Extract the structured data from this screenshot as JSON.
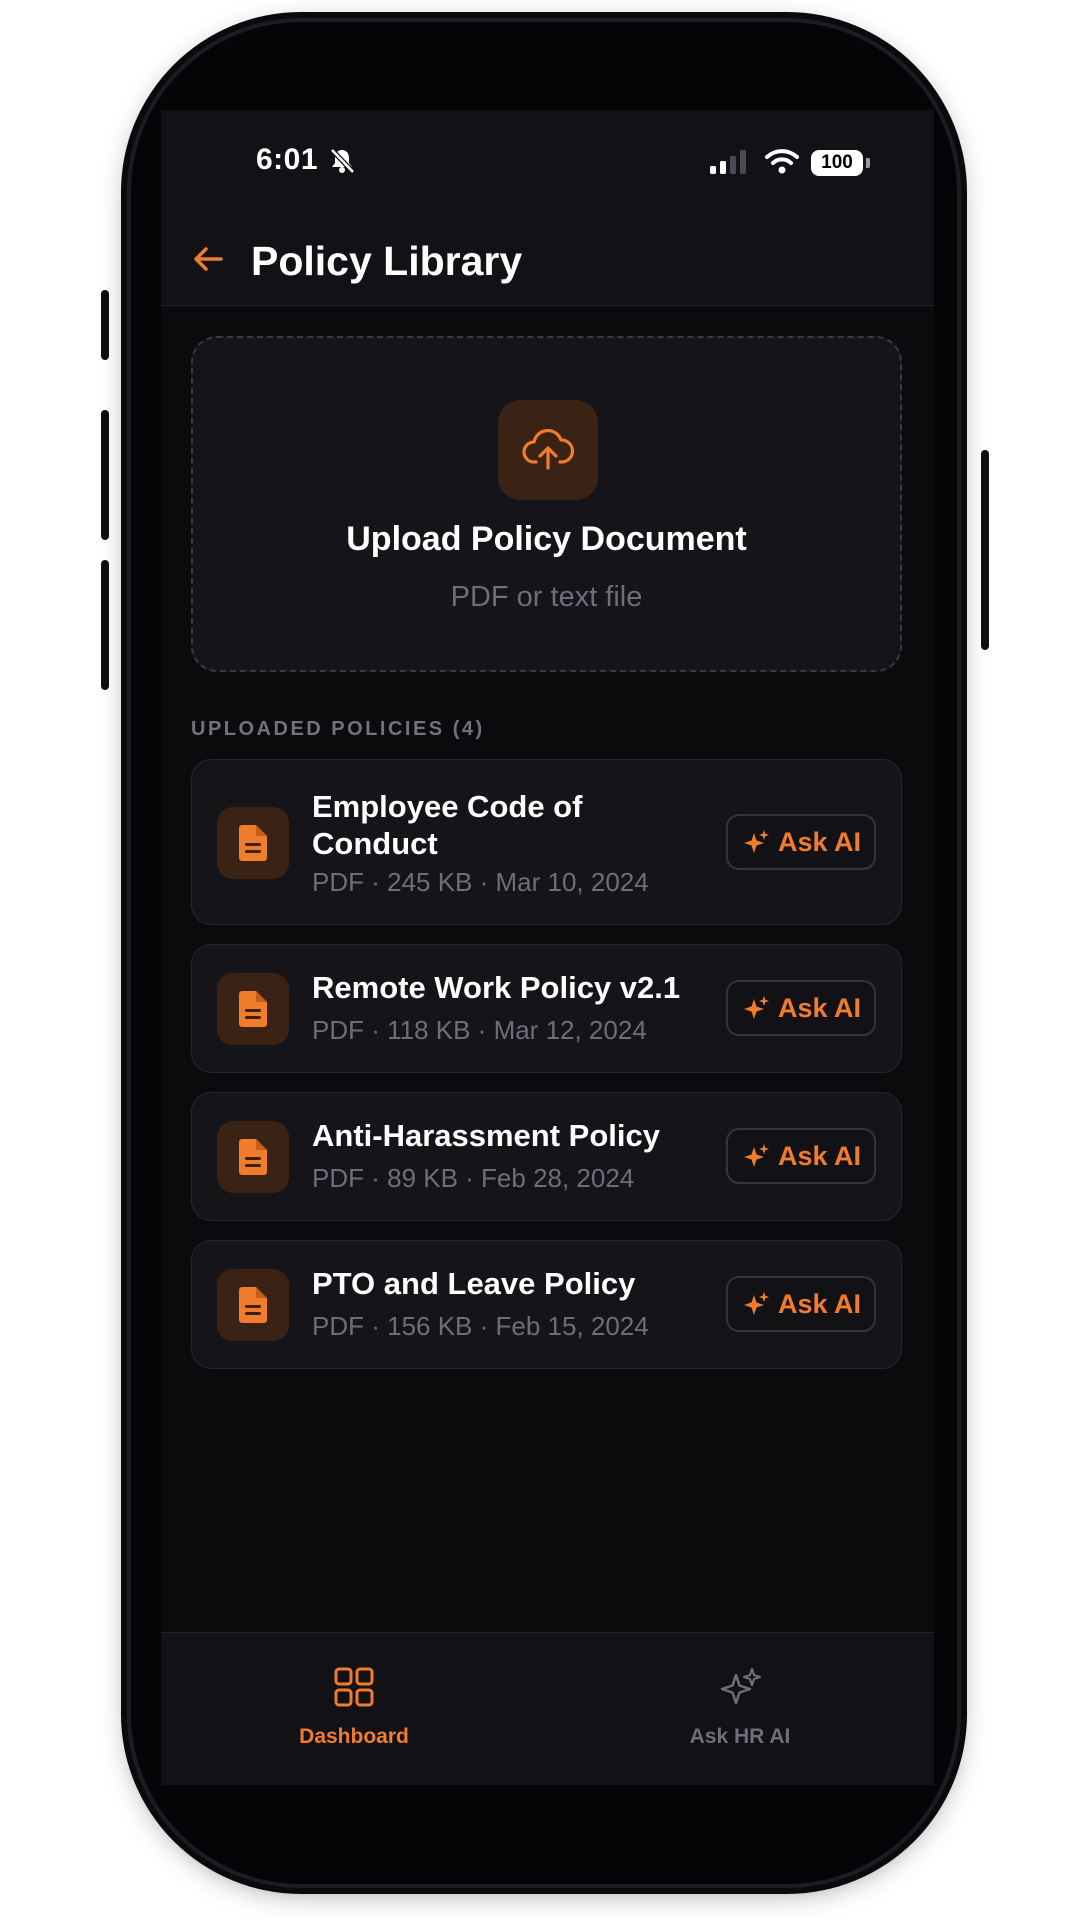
{
  "status_bar": {
    "time": "6:01",
    "battery": "100"
  },
  "header": {
    "title": "Policy Library"
  },
  "upload": {
    "title": "Upload Policy Document",
    "subtitle": "PDF or text file"
  },
  "section": {
    "label": "UPLOADED POLICIES (4)"
  },
  "policies": [
    {
      "title": "Employee Code of Conduct",
      "meta": "PDF · 245 KB · Mar 10, 2024",
      "action": "Ask AI"
    },
    {
      "title": "Remote Work Policy v2.1",
      "meta": "PDF · 118 KB · Mar 12, 2024",
      "action": "Ask AI"
    },
    {
      "title": "Anti-Harassment Policy",
      "meta": "PDF · 89 KB · Feb 28, 2024",
      "action": "Ask AI"
    },
    {
      "title": "PTO and Leave Policy",
      "meta": "PDF · 156 KB · Feb 15, 2024",
      "action": "Ask AI"
    }
  ],
  "bottom_nav": {
    "items": [
      {
        "label": "Dashboard",
        "icon": "grid-icon",
        "active": true
      },
      {
        "label": "Ask HR AI",
        "icon": "sparkles-icon",
        "active": false
      }
    ]
  },
  "colors": {
    "accent": "#f07c2c",
    "background": "#0b0b0e",
    "card": "#141419",
    "muted_text": "#6c6e7a",
    "inactive_nav": "#6c6e7a"
  }
}
